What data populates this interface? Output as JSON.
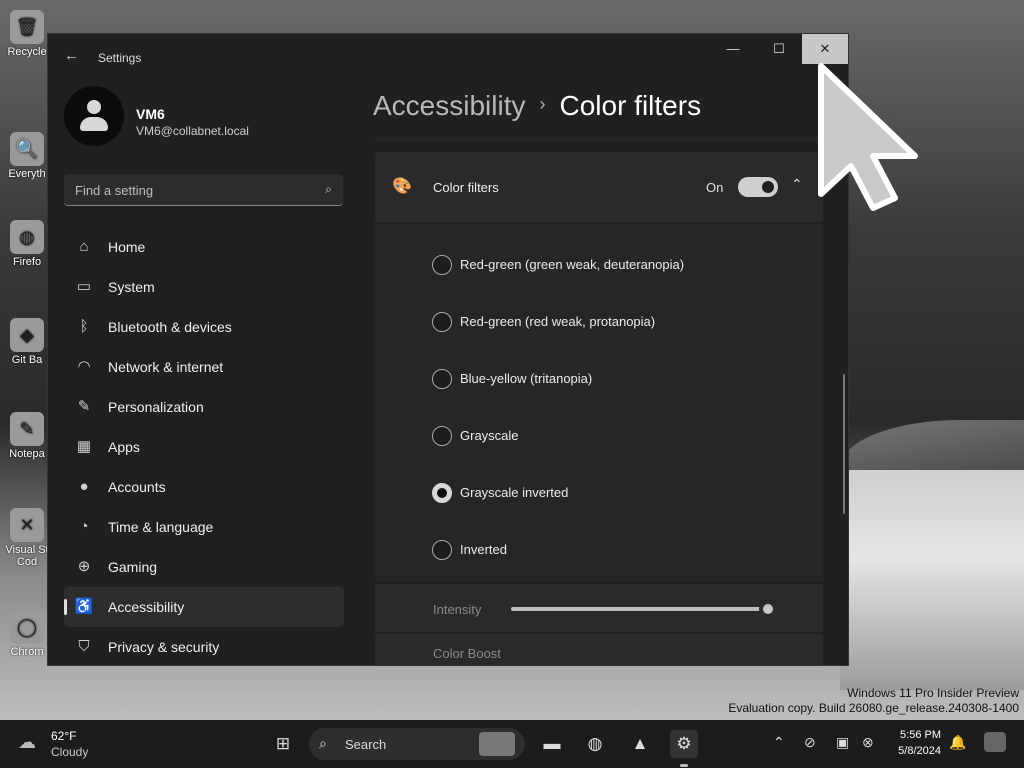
{
  "desktop": {
    "icons": [
      {
        "label": "Recycle",
        "glyph": "🗑"
      },
      {
        "label": "Everyth",
        "glyph": "🔍"
      },
      {
        "label": "Firefo",
        "glyph": "◍"
      },
      {
        "label": "Git Ba",
        "glyph": "◆"
      },
      {
        "label": "Notepa",
        "glyph": "✎"
      },
      {
        "label": "Visual St Cod",
        "glyph": "✕"
      },
      {
        "label": "Chrom",
        "glyph": "◯"
      }
    ],
    "watermark_line1": "Windows 11 Pro Insider Preview",
    "watermark_line2": "Evaluation copy. Build 26080.ge_release.240308-1400"
  },
  "window": {
    "app_title": "Settings",
    "back_icon": "←",
    "min_icon": "—",
    "max_icon": "☐",
    "close_icon": "✕"
  },
  "profile": {
    "name": "VM6",
    "email": "VM6@collabnet.local"
  },
  "search": {
    "placeholder": "Find a setting",
    "icon": "⌕"
  },
  "nav": [
    {
      "label": "Home",
      "icon": "⌂"
    },
    {
      "label": "System",
      "icon": "▭"
    },
    {
      "label": "Bluetooth & devices",
      "icon": "ᛒ"
    },
    {
      "label": "Network & internet",
      "icon": "◠"
    },
    {
      "label": "Personalization",
      "icon": "✎"
    },
    {
      "label": "Apps",
      "icon": "▦"
    },
    {
      "label": "Accounts",
      "icon": "●"
    },
    {
      "label": "Time & language",
      "icon": "◔"
    },
    {
      "label": "Gaming",
      "icon": "⊕"
    },
    {
      "label": "Accessibility",
      "icon": "♿",
      "active": true
    },
    {
      "label": "Privacy & security",
      "icon": "⛉"
    }
  ],
  "breadcrumb": {
    "parent": "Accessibility",
    "separator": "›",
    "current": "Color filters"
  },
  "color_filters": {
    "title": "Color filters",
    "state_label": "On",
    "toggle_on": true,
    "chevron": "⌃",
    "palette_icon": "🎨",
    "options": [
      {
        "label": "Red-green (green weak, deuteranopia)",
        "checked": false
      },
      {
        "label": "Red-green (red weak, protanopia)",
        "checked": false
      },
      {
        "label": "Blue-yellow (tritanopia)",
        "checked": false
      },
      {
        "label": "Grayscale",
        "checked": false
      },
      {
        "label": "Grayscale inverted",
        "checked": true
      },
      {
        "label": "Inverted",
        "checked": false
      }
    ],
    "intensity_label": "Intensity",
    "intensity_value_fraction": 1.0,
    "color_boost_label": "Color Boost"
  },
  "taskbar": {
    "weather_icon": "☁",
    "weather_temp": "62°F",
    "weather_desc": "Cloudy",
    "start_icon": "⊞",
    "search_icon": "⌕",
    "search_placeholder": "Search",
    "apps": [
      {
        "name": "file-explorer",
        "glyph": "▬"
      },
      {
        "name": "firefox",
        "glyph": "◍"
      },
      {
        "name": "app",
        "glyph": "▲"
      },
      {
        "name": "settings",
        "glyph": "⚙"
      }
    ],
    "tray": {
      "chevron": "⌃",
      "network": "⊘",
      "device": "▣",
      "volume": "⊗"
    },
    "time": "5:56 PM",
    "date": "5/8/2024",
    "bell": "🔔"
  }
}
